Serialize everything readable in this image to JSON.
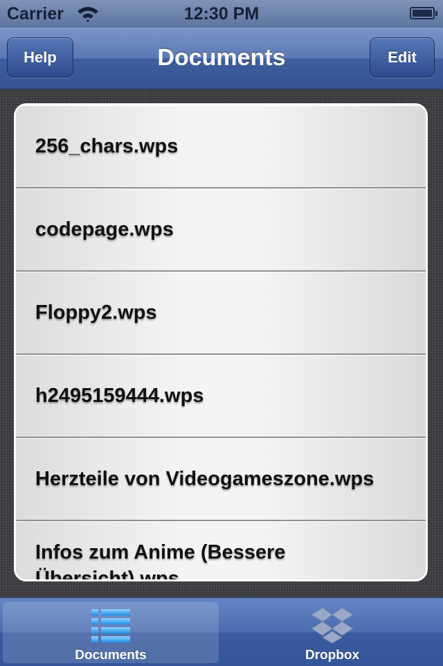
{
  "status_bar": {
    "carrier": "Carrier",
    "time": "12:30 PM"
  },
  "nav": {
    "title": "Documents",
    "left_button": "Help",
    "right_button": "Edit"
  },
  "documents": [
    {
      "name": "256_chars.wps"
    },
    {
      "name": "codepage.wps"
    },
    {
      "name": "Floppy2.wps"
    },
    {
      "name": "h2495159444.wps"
    },
    {
      "name": "Herzteile von Videogameszone.wps"
    },
    {
      "name": "Infos zum Anime (Bessere Übersicht).wps"
    }
  ],
  "tab_bar": {
    "tabs": [
      {
        "label": "Documents",
        "icon": "list-icon",
        "selected": true
      },
      {
        "label": "Dropbox",
        "icon": "dropbox-icon",
        "selected": false
      }
    ]
  },
  "colors": {
    "nav_blue": "#4a69aa",
    "tab_blue": "#4b6cb0",
    "list_background": "#f2f2f2"
  }
}
